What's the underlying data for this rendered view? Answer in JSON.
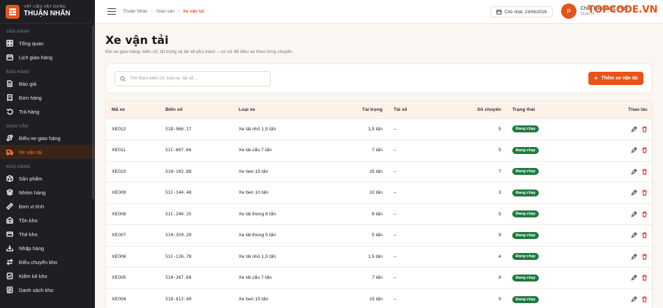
{
  "brand": {
    "subtitle": "VẬT LIỆU XÂY DỰNG",
    "name": "THUẬN NHẤN"
  },
  "sidebar": {
    "sections": [
      {
        "title": "VẬN HÀNH",
        "items": [
          {
            "label": "Tổng quan",
            "icon": "grid-icon"
          },
          {
            "label": "Lịch giao hàng",
            "icon": "calendar-icon"
          }
        ]
      },
      {
        "title": "BÁN HÀNG",
        "items": [
          {
            "label": "Báo giá",
            "icon": "document-icon"
          },
          {
            "label": "Đơn hàng",
            "icon": "receipt-icon"
          },
          {
            "label": "Trả hàng",
            "icon": "return-icon"
          }
        ]
      },
      {
        "title": "GIAO VẬN",
        "items": [
          {
            "label": "Điều xe giao hàng",
            "icon": "route-icon"
          },
          {
            "label": "Xe vận tải",
            "icon": "truck-icon",
            "active": true
          }
        ]
      },
      {
        "title": "KHO HÀNG",
        "items": [
          {
            "label": "Sản phẩm",
            "icon": "box-icon"
          },
          {
            "label": "Nhóm hàng",
            "icon": "layers-icon"
          },
          {
            "label": "Đơn vị tính",
            "icon": "ruler-icon"
          },
          {
            "label": "Tồn kho",
            "icon": "warehouse-icon"
          },
          {
            "label": "Thẻ kho",
            "icon": "card-icon"
          },
          {
            "label": "Nhập hàng",
            "icon": "import-icon"
          },
          {
            "label": "Điều chuyển kho",
            "icon": "transfer-icon"
          },
          {
            "label": "Kiểm kê kho",
            "icon": "checklist-icon"
          },
          {
            "label": "Danh sách kho",
            "icon": "list-icon"
          }
        ]
      }
    ]
  },
  "topbar": {
    "breadcrumb": [
      "Thuận Nhân",
      "Giao vận",
      "Xe vận tải"
    ],
    "date": "Chủ nhật, 23/08/2026",
    "greeting": "Chào buổi sáng, Phát",
    "role": "Quản trị",
    "avatar": "P",
    "badge": "TOPCODE.VN"
  },
  "page": {
    "title": "Xe vận tải",
    "description": "Đội xe giao hàng: biển số, tải trọng và tài xế phụ trách – cơ sở để điều xe theo từng chuyến.",
    "search_placeholder": "Tìm theo biển số, loại xe, tài xế...",
    "add_label": "Thêm xe vận tải"
  },
  "table": {
    "headers": [
      "Mã xe",
      "Biển số",
      "Loại xe",
      "Tải trọng",
      "Tài xế",
      "Số chuyến",
      "Trạng thái",
      "Thao tác"
    ],
    "rows": [
      {
        "code": "XE012",
        "plate": "51D-966.17",
        "type": "Xe tải nhỏ 1,5 tấn",
        "load": "1,5 tấn",
        "driver": "–",
        "trips": "5",
        "status": "Đang chạy"
      },
      {
        "code": "XE011",
        "plate": "51C-607.66",
        "type": "Xe tải cẩu 7 tấn",
        "load": "7 tấn",
        "driver": "–",
        "trips": "5",
        "status": "Đang chạy"
      },
      {
        "code": "XE010",
        "plate": "51H-102.88",
        "type": "Xe ben 15 tấn",
        "load": "15 tấn",
        "driver": "–",
        "trips": "7",
        "status": "Đang chạy"
      },
      {
        "code": "XE009",
        "plate": "51C-144.48",
        "type": "Xe ben 10 tấn",
        "load": "10 tấn",
        "driver": "–",
        "trips": "3",
        "status": "Đang chạy"
      },
      {
        "code": "XE008",
        "plate": "51C-246.25",
        "type": "Xe tải thùng 8 tấn",
        "load": "8 tấn",
        "driver": "–",
        "trips": "5",
        "status": "Đang chạy"
      },
      {
        "code": "XE007",
        "plate": "51H-350.29",
        "type": "Xe tải thùng 5 tấn",
        "load": "5 tấn",
        "driver": "–",
        "trips": "9",
        "status": "Đang chạy"
      },
      {
        "code": "XE006",
        "plate": "51C-126.78",
        "type": "Xe tải nhỏ 1,5 tấn",
        "load": "1,5 tấn",
        "driver": "–",
        "trips": "4",
        "status": "Đang chạy"
      },
      {
        "code": "XE005",
        "plate": "51H-267.68",
        "type": "Xe tải cẩu 7 tấn",
        "load": "7 tấn",
        "driver": "–",
        "trips": "8",
        "status": "Đang chạy"
      },
      {
        "code": "XE004",
        "plate": "51D-612.49",
        "type": "Xe ben 15 tấn",
        "load": "15 tấn",
        "driver": "–",
        "trips": "9",
        "status": "Đang chạy"
      }
    ]
  },
  "colors": {
    "accent": "#e8531a",
    "sidebar_bg": "#1e1f22",
    "status_green": "#1f7a3f",
    "delete_red": "#d63b3b"
  }
}
